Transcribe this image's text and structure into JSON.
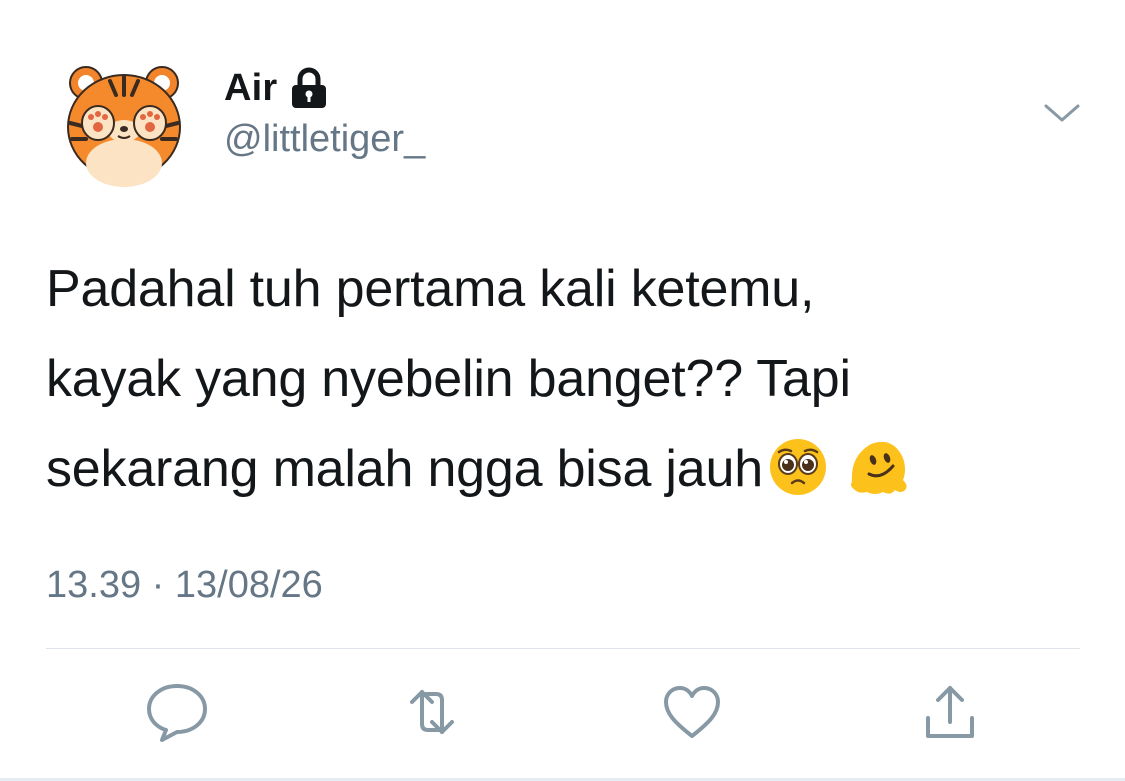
{
  "tweet": {
    "display_name": "Air",
    "handle": "@littletiger_",
    "text": "Padahal tuh pertama kali ketemu,\nkayak yang nyebelin banget?? Tapi\nsekarang malah ngga bisa jauh",
    "emojis": [
      "pleading-face-emoji",
      "melting-face-emoji"
    ],
    "timestamp": "13.39 · 13/08/26",
    "protected": true
  },
  "icons": {
    "avatar": "tiger-avatar",
    "lock": "lock-icon",
    "caret": "chevron-down-icon",
    "reply": "reply-icon",
    "retweet": "retweet-icon",
    "like": "heart-icon",
    "share": "share-icon"
  },
  "colors": {
    "text": "#14171a",
    "secondary": "#657786",
    "icon": "#8899a6",
    "divider": "#dde3e8"
  }
}
